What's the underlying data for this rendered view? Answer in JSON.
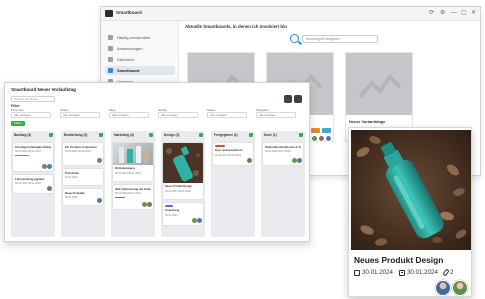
{
  "back_window": {
    "app_title": "Smartboard",
    "controls": [
      "⟳",
      "⚙",
      "—",
      "▢",
      "✕"
    ],
    "sidebar_items": [
      {
        "label": "Häufig verwendete",
        "active": false
      },
      {
        "label": "Anwendungen",
        "active": false
      },
      {
        "label": "Übersicht",
        "active": false
      },
      {
        "label": "Smartboard",
        "active": true
      },
      {
        "label": "Vorlagen",
        "active": false
      }
    ],
    "main_title": "Aktuelle Smartboards, in denen ich involviert bin",
    "search_placeholder": "Suchbegriff eingeben",
    "boards": [
      {
        "label": ""
      },
      {
        "label": ""
      },
      {
        "label": "Neuer Vorlaufstage"
      }
    ]
  },
  "board_window": {
    "title": "Smartboard Neuer Vorlaufstag",
    "search_placeholder": "Suchen auf Board",
    "filters_label": "Filter",
    "filters": [
      {
        "label": "Personen",
        "value": "Alle anzeigen"
      },
      {
        "label": "Status",
        "value": "Alle anzeigen"
      },
      {
        "label": "Tags",
        "value": "Alle anzeigen"
      },
      {
        "label": "Häufig",
        "value": "Alle anzeigen"
      },
      {
        "label": "Status",
        "value": "Alle anzeigen"
      },
      {
        "label": "Kategorie",
        "value": "Alle anzeigen"
      }
    ],
    "filter_button": "Filtern",
    "columns": [
      {
        "title": "Backlog (3)",
        "cards": [
          {
            "title": "Grundgerüstaufgabe Nation",
            "dates": "30.01.2024 30.01.2024"
          },
          {
            "title": "Laborprüfung geplant",
            "dates": "30.01.2024 30.01.2024"
          }
        ]
      },
      {
        "title": "Bearbeitung (3)",
        "cards": [
          {
            "title": "Ein Produkt vorbereiten",
            "dates": "30.01.2024 30.01.2024"
          },
          {
            "title": "Preislisten",
            "dates": "30.01.2024"
          },
          {
            "title": "Neue Produkte",
            "dates": "30.01.2024"
          }
        ]
      },
      {
        "title": "Marketing (3)",
        "cards": [
          {
            "title": "Werbekampagne",
            "dates": "30.01.2024 30.01.2024"
          },
          {
            "title": "Web Optimierung der Kategorie",
            "dates": "30.01.2024 30.01.2024"
          }
        ]
      },
      {
        "title": "Design (2)",
        "cards": [
          {
            "title": "Neues Produkt Design",
            "dates": "30.01.2024 30.01.2024"
          },
          {
            "title": "Verpackung",
            "dates": "30.01.2024"
          }
        ]
      },
      {
        "title": "Freigegeben (1)",
        "cards": [
          {
            "title": "Flyer zusammenfassen",
            "dates": "30.01.2024 30.01.2024"
          }
        ]
      },
      {
        "title": "Done (1)",
        "cards": [
          {
            "title": "Daten Messfunktionen in Kontakt",
            "dates": "30.01.2024 30.01.2024"
          }
        ]
      }
    ]
  },
  "detail_card": {
    "title": "Neues Produkt Design",
    "start_date": "30.01.2024",
    "end_date": "30.01.2024",
    "attachments": "2",
    "colors": {
      "bottle": "#2fb2a6",
      "background": "#4a3426"
    }
  }
}
